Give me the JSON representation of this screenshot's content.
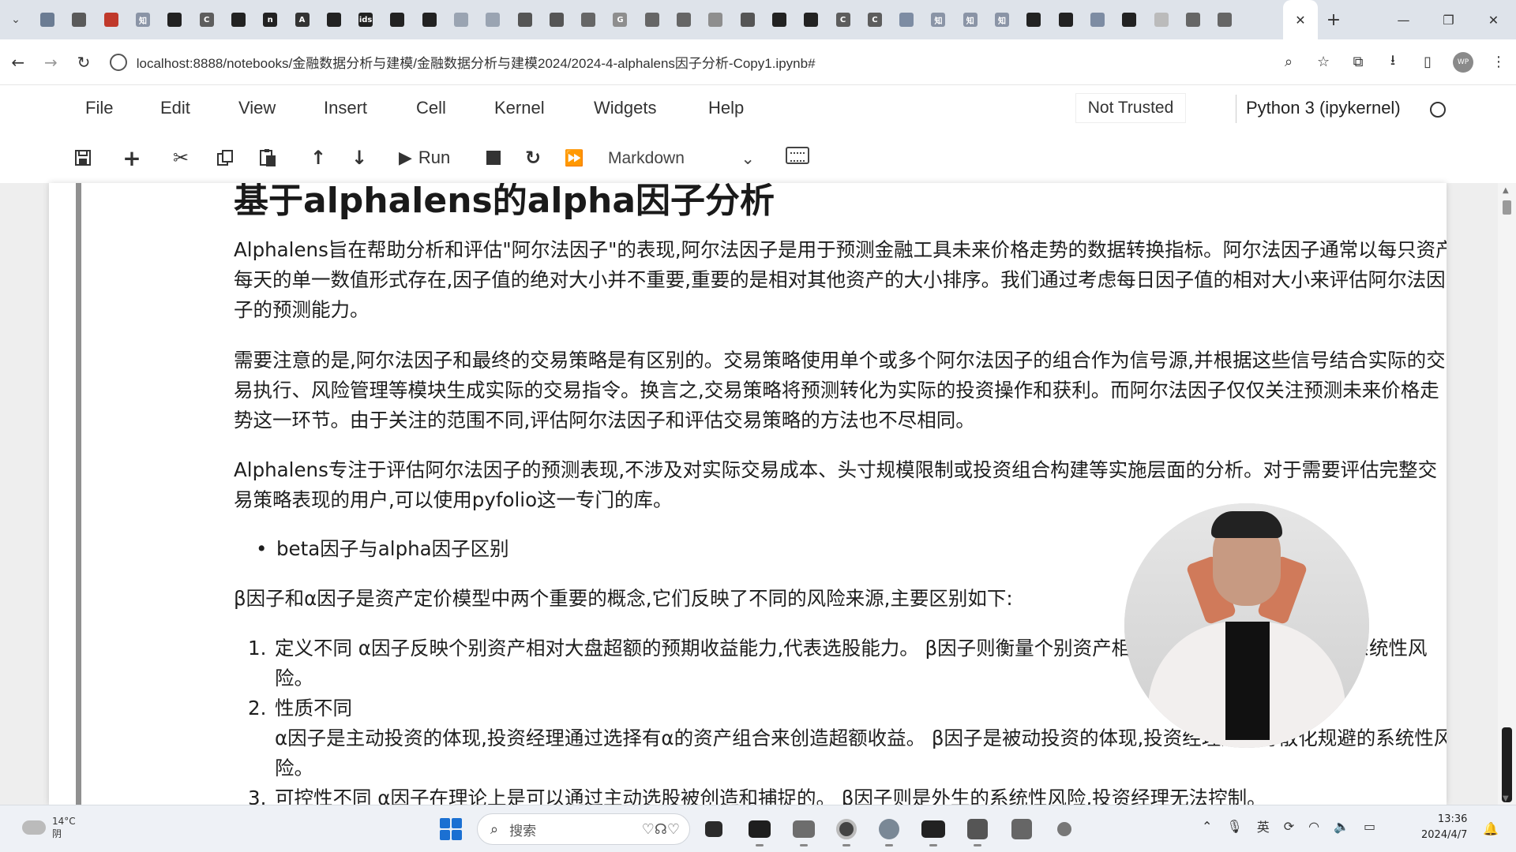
{
  "browser": {
    "tabs": [
      {
        "icon": "calendar-icon",
        "color": "#6b7c93",
        "label": ""
      },
      {
        "icon": "bilibili-icon",
        "color": "#5a5a5a",
        "label": ""
      },
      {
        "icon": "play-icon",
        "color": "#c0392b",
        "label": ""
      },
      {
        "icon": "zhihu-icon",
        "color": "#8a94a6",
        "label": "知"
      },
      {
        "icon": "github-icon",
        "color": "#222222",
        "label": ""
      },
      {
        "icon": "csdn-icon",
        "color": "#5d5d5d",
        "label": "C"
      },
      {
        "icon": "github-icon",
        "color": "#222222",
        "label": ""
      },
      {
        "icon": "notion-icon",
        "color": "#222222",
        "label": "n"
      },
      {
        "icon": "a-icon",
        "color": "#333333",
        "label": "A"
      },
      {
        "icon": "youtube-icon",
        "color": "#222222",
        "label": ""
      },
      {
        "icon": "ids-icon",
        "color": "#222222",
        "label": "ids"
      },
      {
        "icon": "terminal-icon",
        "color": "#222222",
        "label": ""
      },
      {
        "icon": "terminal-icon",
        "color": "#222222",
        "label": ""
      },
      {
        "icon": "cloud-icon",
        "color": "#9aa4b2",
        "label": ""
      },
      {
        "icon": "cloud-icon",
        "color": "#9aa4b2",
        "label": ""
      },
      {
        "icon": "runner-icon",
        "color": "#555555",
        "label": ""
      },
      {
        "icon": "book-icon",
        "color": "#555555",
        "label": ""
      },
      {
        "icon": "paw-icon",
        "color": "#666666",
        "label": ""
      },
      {
        "icon": "google-icon",
        "color": "#8e8e8e",
        "label": "G"
      },
      {
        "icon": "globe-icon",
        "color": "#666666",
        "label": ""
      },
      {
        "icon": "doc-icon",
        "color": "#666666",
        "label": ""
      },
      {
        "icon": "bird-icon",
        "color": "#8e8e8e",
        "label": ""
      },
      {
        "icon": "book-icon",
        "color": "#555555",
        "label": ""
      },
      {
        "icon": "github-icon",
        "color": "#222222",
        "label": ""
      },
      {
        "icon": "github-icon",
        "color": "#222222",
        "label": ""
      },
      {
        "icon": "csdn-icon",
        "color": "#5d5d5d",
        "label": "C"
      },
      {
        "icon": "csdn-icon",
        "color": "#5d5d5d",
        "label": "C"
      },
      {
        "icon": "globe-icon",
        "color": "#7d8ca3",
        "label": ""
      },
      {
        "icon": "zhihu-icon",
        "color": "#8a94a6",
        "label": "知"
      },
      {
        "icon": "zhihu-icon",
        "color": "#8a94a6",
        "label": "知"
      },
      {
        "icon": "zhihu-icon",
        "color": "#8a94a6",
        "label": "知"
      },
      {
        "icon": "github-icon",
        "color": "#222222",
        "label": ""
      },
      {
        "icon": "github-icon",
        "color": "#222222",
        "label": ""
      },
      {
        "icon": "globe-icon",
        "color": "#7d8ca3",
        "label": ""
      },
      {
        "icon": "github-icon",
        "color": "#222222",
        "label": ""
      },
      {
        "icon": "loading-icon",
        "color": "#bbbbbb",
        "label": ""
      },
      {
        "icon": "book-icon",
        "color": "#666666",
        "label": ""
      },
      {
        "icon": "book-icon",
        "color": "#666666",
        "label": ""
      }
    ],
    "active_tab_close": "✕",
    "new_tab": "+",
    "url": "localhost:8888/notebooks/金融数据分析与建模/金融数据分析与建模2024/2024-4-alphalens因子分析-Copy1.ipynb#",
    "profile_initials": "WP"
  },
  "jupyter": {
    "menu": [
      "File",
      "Edit",
      "View",
      "Insert",
      "Cell",
      "Kernel",
      "Widgets",
      "Help"
    ],
    "trust_status": "Not Trusted",
    "kernel_name": "Python 3 (ipykernel)",
    "run_label": "Run",
    "cell_type": "Markdown"
  },
  "notebook": {
    "heading": "基于alphalens的alpha因子分析",
    "paragraphs": [
      "Alphalens旨在帮助分析和评估\"阿尔法因子\"的表现,阿尔法因子是用于预测金融工具未来价格走势的数据转换指标。阿尔法因子通常以每只资产每天的单一数值形式存在,因子值的绝对大小并不重要,重要的是相对其他资产的大小排序。我们通过考虑每日因子值的相对大小来评估阿尔法因子的预测能力。",
      "需要注意的是,阿尔法因子和最终的交易策略是有区别的。交易策略使用单个或多个阿尔法因子的组合作为信号源,并根据这些信号结合实际的交易执行、风险管理等模块生成实际的交易指令。换言之,交易策略将预测转化为实际的投资操作和获利。而阿尔法因子仅仅关注预测未来价格走势这一环节。由于关注的范围不同,评估阿尔法因子和评估交易策略的方法也不尽相同。",
      "Alphalens专注于评估阿尔法因子的预测表现,不涉及对实际交易成本、头寸规模限制或投资组合构建等实施层面的分析。对于需要评估完整交易策略表现的用户,可以使用pyfolio这一专门的库。"
    ],
    "bullet": "beta因子与alpha因子区别",
    "intro": "β因子和α因子是资产定价模型中两个重要的概念,它们反映了不同的风险来源,主要区别如下:",
    "list": [
      {
        "num": "1.",
        "title": "定义不同",
        "body": "α因子反映个别资产相对大盘超额的预期收益能力,代表选股能力。 β因子则衡量个别资产相对于大盘的敏感程度,反映系统性风险。"
      },
      {
        "num": "2.",
        "title": "性质不同",
        "body": "α因子是主动投资的体现,投资经理通过选择有α的资产组合来创造超额收益。 β因子是被动投资的体现,投资经理通过分散化规避的系统性风险。"
      },
      {
        "num": "3.",
        "title": "可控性不同",
        "body": "α因子在理论上是可以通过主动选股被创造和捕捉的。 β因子则是外生的系统性风险,投资经理无法控制。"
      }
    ]
  },
  "taskbar": {
    "temperature": "14°C",
    "weather": "阴",
    "search_placeholder": "搜索",
    "tray_ime": "英",
    "time": "13:36",
    "date": "2024/4/7"
  }
}
